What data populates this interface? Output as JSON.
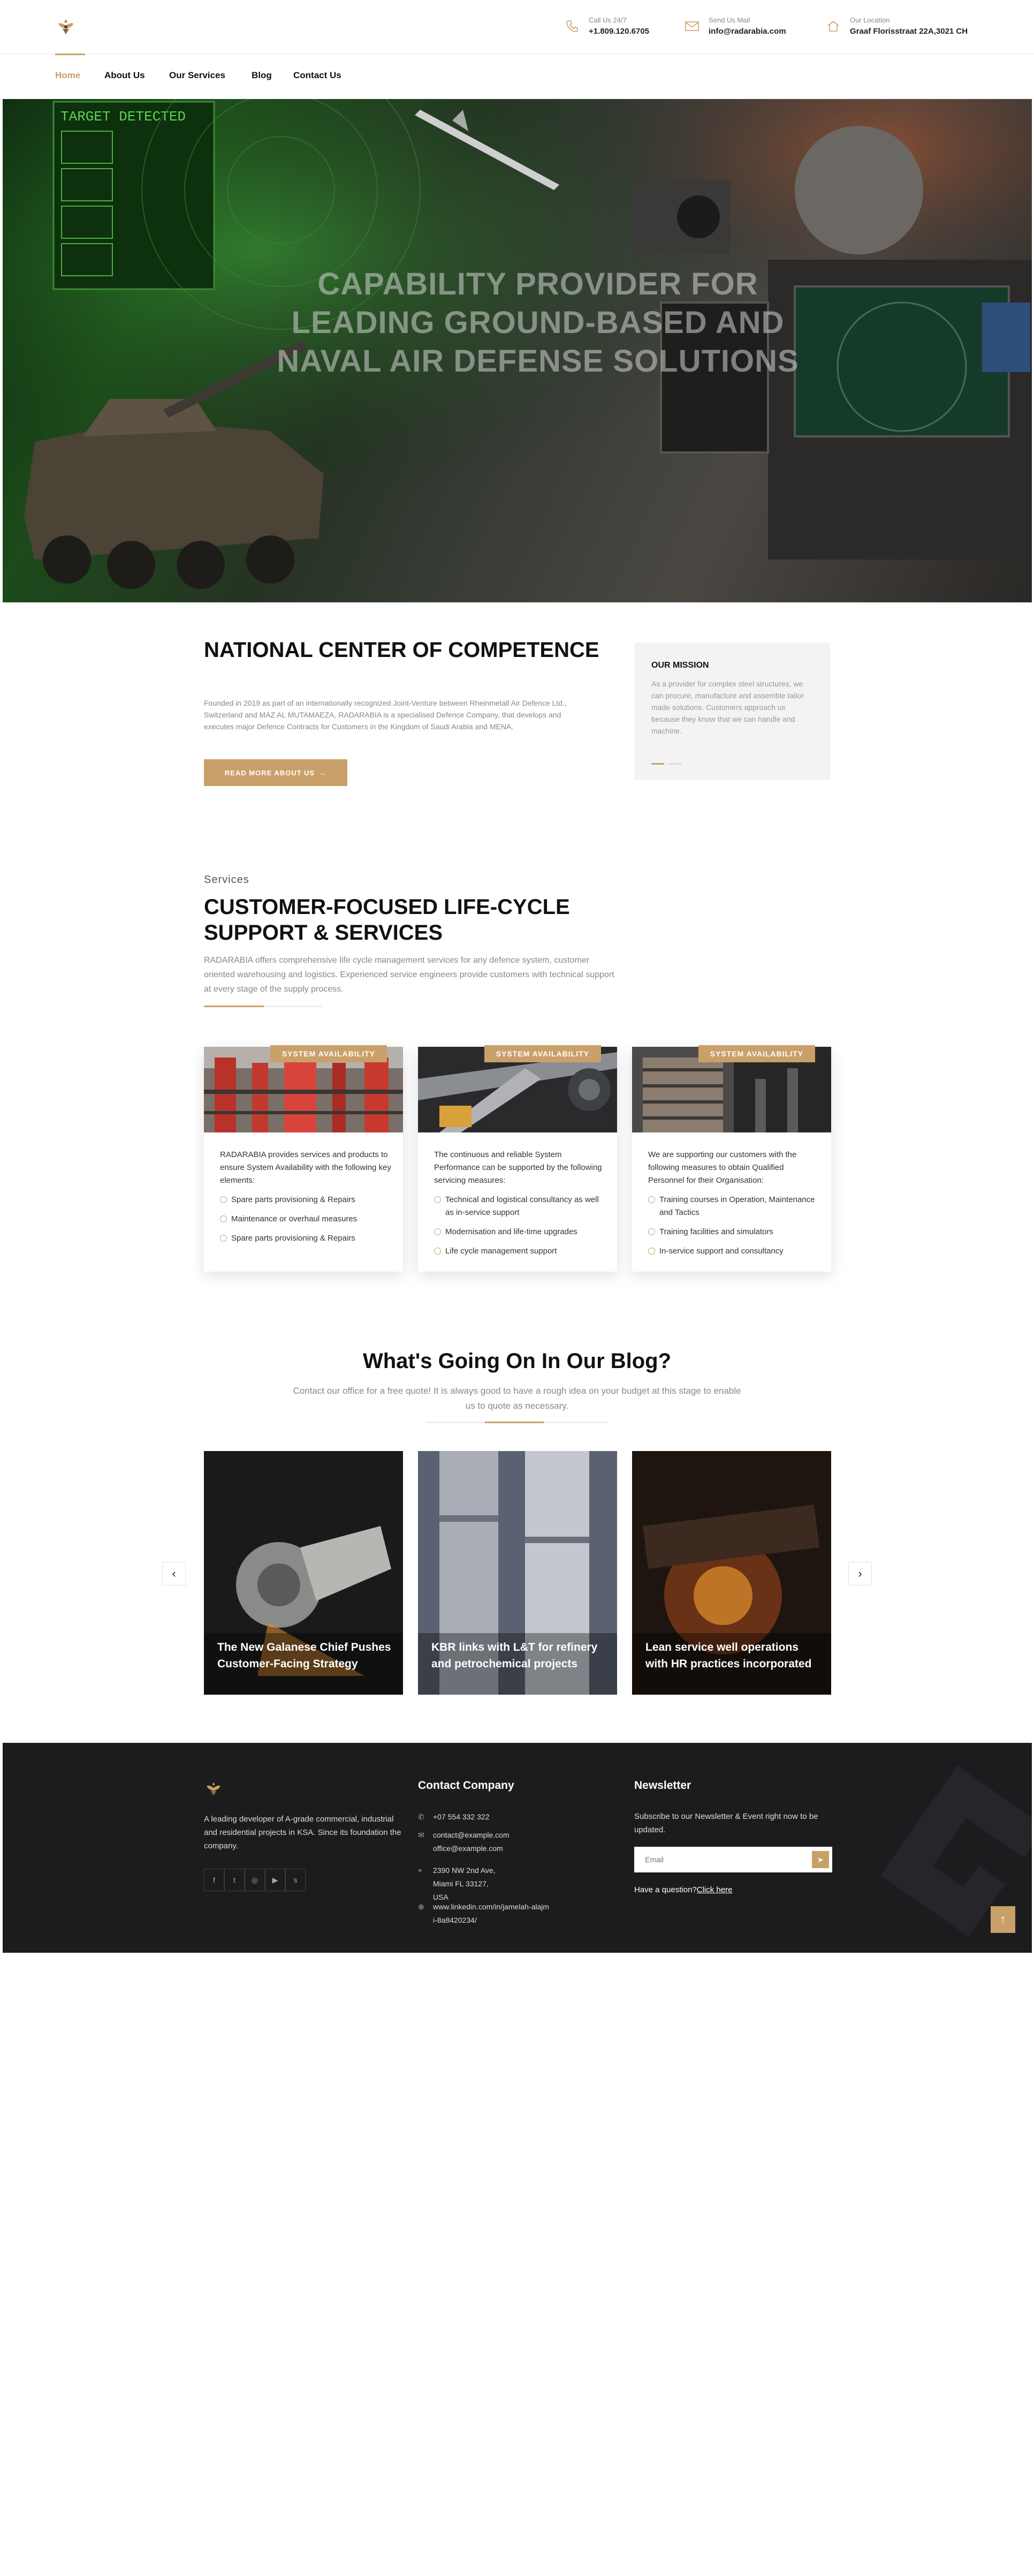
{
  "brand": {
    "logo_icon": "eagle-emblem-icon",
    "accent": "#c9a06a"
  },
  "contacts": [
    {
      "icon": "phone-icon",
      "label": "Call Us 24/7",
      "value": "+1.809.120.6705"
    },
    {
      "icon": "mail-icon",
      "label": "Send Us Mail",
      "value": "info@radarabia.com"
    },
    {
      "icon": "home-icon",
      "label": "Our Location",
      "value": "Graaf Florisstraat 22A,3021 CH"
    }
  ],
  "nav": {
    "items": [
      "Home",
      "About Us",
      "Our Services",
      "Blog",
      "Contact Us"
    ],
    "active": "Home"
  },
  "hero": {
    "title": "Capability provider for leading ground-based and naval air defense solutions"
  },
  "national_center": {
    "title": "NATIONAL CENTER OF COMPETENCE",
    "text": "Founded in 2019 as part of an internationally recognized Joint-Venture between Rheinmetall Air Defence Ltd., Switzerland and MAZ AL MUTAMAEZA, RADARABIA is a specialised Defence Company, that develops and executes major Defence Contracts for Customers in the Kingdom of Saudi Arabia and MENA.",
    "button": "READ MORE ABOUT US",
    "button_icon": "arrow-right-icon"
  },
  "mission": {
    "title": "OUR MISSION",
    "text": "As a provider for complex steel structures, we can procure, manufacture and assemble tailor made solutions. Customers approach us because they know that we can handle and machine."
  },
  "services": {
    "kicker": "Services",
    "title": "CUSTOMER-FOCUSED LIFE-CYCLE SUPPORT & SERVICES",
    "text": "RADARABIA offers comprehensive life cycle management services for any defence system, customer oriented warehousing and logistics. Experienced service engineers provide customers with technical support at every stage of the supply process.",
    "cards": [
      {
        "badge": "SYSTEM AVAILABILITY",
        "intro": "RADARABIA provides services and products to ensure System Availability with the following key elements:",
        "items": [
          "Spare parts provisioning & Repairs",
          "Maintenance or overhaul measures",
          "Spare parts provisioning & Repairs"
        ]
      },
      {
        "badge": "SYSTEM AVAILABILITY",
        "intro": "The continuous and reliable System Performance can be supported by the following servicing measures:",
        "items": [
          "Technical and logistical consultancy as well as in-service support",
          "Modernisation and life-time upgrades",
          "Life cycle management support"
        ]
      },
      {
        "badge": "SYSTEM AVAILABILITY",
        "intro": "We are supporting our customers with the following measures to obtain Qualified Personnel for their Organisation:",
        "items": [
          "Training courses in Operation, Maintenance and Tactics",
          "Training facilities and simulators",
          "In-service support and consultancy"
        ]
      }
    ]
  },
  "blog": {
    "title": "What's Going On In Our Blog?",
    "subtitle": "Contact our office for a free quote! It is always good to have a rough idea on your budget at this stage to enable us to quote as necessary.",
    "posts": [
      {
        "title": "The New Galanese Chief Pushes Customer-Facing Strategy"
      },
      {
        "title": "KBR links with L&T for refinery and petrochemical projects"
      },
      {
        "title": "Lean service well operations with HR practices incorporated"
      }
    ],
    "prev_icon": "chevron-left-icon",
    "next_icon": "chevron-right-icon"
  },
  "footer": {
    "about": "A leading developer of A-grade commercial, industrial and residential projects in KSA. Since its foundation the company.",
    "social": [
      "facebook-icon",
      "twitter-icon",
      "instagram-icon",
      "youtube-icon",
      "skype-icon"
    ],
    "contact_title": "Contact Company",
    "phone": "+07 554 332 322",
    "email1": "contact@example.com",
    "email2": "office@example.com",
    "address": "2390 NW 2nd Ave, Miami FL 33127, USA",
    "linkedin": "www.linkedin.com/in/jamelah-alajmi-8a8420234/",
    "newsletter_title": "Newsletter",
    "newsletter_text": "Subscribe to our Newsletter & Event right now to be updated.",
    "email_placeholder": "Email",
    "question": "Have a question?",
    "question_link": "Click here"
  },
  "to_top_icon": "arrow-up-icon"
}
